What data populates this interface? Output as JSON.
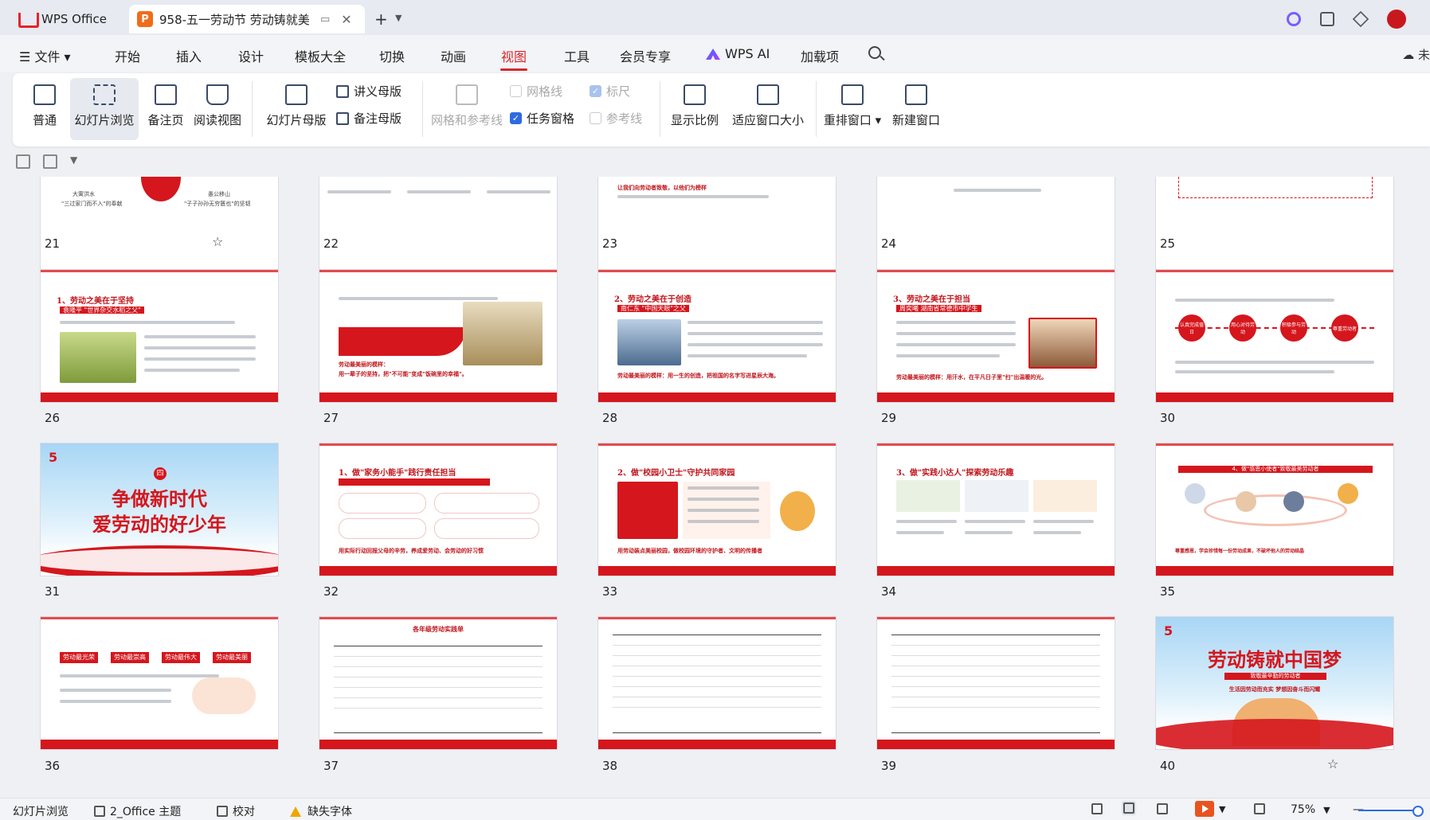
{
  "window": {
    "home_tab": "WPS Office",
    "doc_tab": "958-五一劳动节 劳动铸就美",
    "doc_tab_icon": "P",
    "new_tab": "+"
  },
  "menu": {
    "items": [
      "文件",
      "开始",
      "插入",
      "设计",
      "模板大全",
      "切换",
      "动画",
      "视图",
      "工具",
      "会员专享",
      "WPS AI",
      "加载项"
    ],
    "active": "视图",
    "cloud": "未"
  },
  "ribbon": {
    "normal": "普通",
    "slide_sorter": "幻灯片浏览",
    "notes_page": "备注页",
    "reading_view": "阅读视图",
    "slide_master": "幻灯片母版",
    "handout_master": "讲义母版",
    "notes_master": "备注母版",
    "grid_guides": "网格和参考线",
    "gridlines": "网格线",
    "ruler": "标尺",
    "task_pane": "任务窗格",
    "guides": "参考线",
    "zoom_ratio": "显示比例",
    "fit_window": "适应窗口大小",
    "arrange_windows": "重排窗口",
    "new_window": "新建窗口"
  },
  "slides": {
    "numbers": [
      "21",
      "22",
      "23",
      "24",
      "25",
      "26",
      "27",
      "28",
      "29",
      "30",
      "31",
      "32",
      "33",
      "34",
      "35",
      "36",
      "37",
      "38",
      "39",
      "40"
    ],
    "s21_a": "大寓洪水",
    "s21_b": "\"三过家门而不入\"的奉献",
    "s21_c": "愚公移山",
    "s21_d": "\"子子孙孙无穷匮也\"的坚韧",
    "s23": "让我们向劳动者致敬，以他们为榜样",
    "s26_title": "1、劳动之美在于坚持",
    "s26_name": "袁隆平",
    "s26_sub": "\"世界杂交水稻之父\"",
    "s27_t": "劳动最美丽的模样：",
    "s27_b": "用一辈子的坚持，把\"不可能\"变成\"饭碗里的幸福\"。",
    "s28_title": "2、劳动之美在于创造",
    "s28_name": "南仁东",
    "s28_sub": "\"中国天眼\"之父",
    "s28_b": "劳动最美丽的模样：用一生的创造，把祖国的名字写进星辰大海。",
    "s29_title": "3、劳动之美在于担当",
    "s29_name": "周奕曦",
    "s29_sub": "湖南省常德市中学生",
    "s29_b": "劳动最美丽的模样：用汗水，在平凡日子里\"扫\"出温暖的光。",
    "s30_c1": "认真完成值日",
    "s30_c2": "用心对待劳动",
    "s30_c3": "积极参与劳动",
    "s30_c4": "尊重劳动者",
    "s31_num": "四",
    "s31_l1": "争做新时代",
    "s31_l2": "爱劳动的好少年",
    "s32_title": "1、做\"家务小能手\"践行责任担当",
    "s32_b": "用实际行动回报父母的辛劳，养成爱劳动、会劳动的好习惯",
    "s33_title": "2、做\"校园小卫士\"守护共同家园",
    "s33_b": "用劳动装点美丽校园，做校园环境的守护者、文明的传播者",
    "s34_title": "3、做\"实践小达人\"探索劳动乐趣",
    "s35_title": "4、做\"感恩小使者\"致敬最美劳动者",
    "s35_b": "尊重感恩，学会珍惜每一份劳动成果，不破坏他人的劳动结晶",
    "s36_tags": [
      "劳动最光荣",
      "劳动最崇高",
      "劳动最伟大",
      "劳动最美丽"
    ],
    "s37_title": "各年级劳动实践单",
    "s40_title": "劳动铸就中国梦",
    "s40_sub": "致敬最辛勤的劳动者",
    "s40_b": "生活因劳动而充实 梦想因奋斗而闪耀"
  },
  "status": {
    "view": "幻灯片浏览",
    "theme": "2_Office 主题",
    "proof": "校对",
    "missing_font": "缺失字体",
    "zoom": "75%"
  },
  "colors": {
    "accent_red": "#d5161d",
    "menu_active": "#d7282b",
    "checkbox_blue": "#2f6bdf"
  }
}
